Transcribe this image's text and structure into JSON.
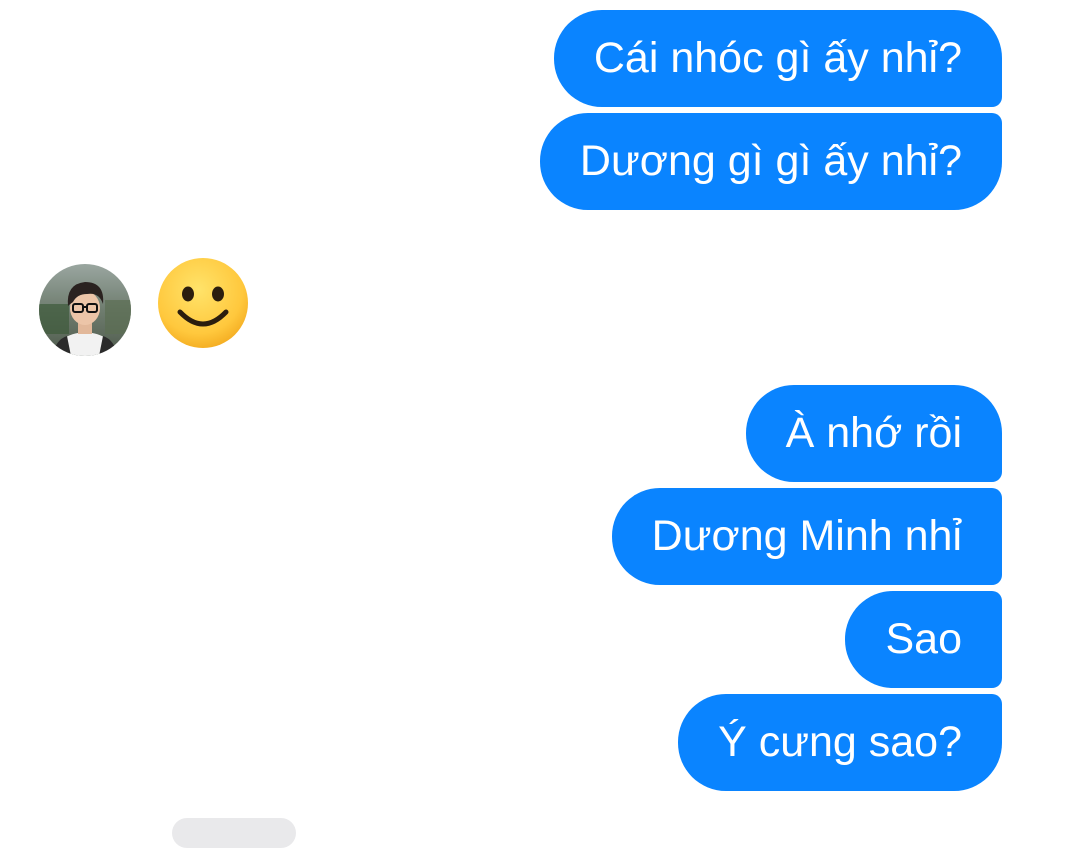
{
  "messages": {
    "outgoing_group_1": [
      "Cái nhóc gì ấy nhỉ?",
      "Dương gì gì ấy nhỉ?"
    ],
    "incoming": {
      "avatar_icon": "user-avatar-photo",
      "emoji_icon": "smiling-face-emoji"
    },
    "outgoing_group_2": [
      "À nhớ rồi",
      "Dương Minh nhỉ",
      "Sao",
      "Ý cưng sao?"
    ]
  },
  "colors": {
    "outgoing_bubble": "#0A84FF",
    "outgoing_text": "#FFFFFF",
    "background": "#FFFFFF",
    "emoji_face": "#FFC83D"
  }
}
